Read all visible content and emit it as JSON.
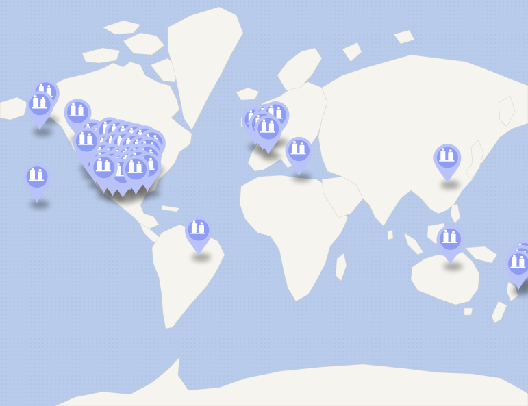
{
  "colors": {
    "water": "#b8cbea",
    "water_dots": "#a9bee3",
    "land": "#f6f4ee",
    "land_edge": "#d9d6cd",
    "marker_fill": "#8e9df2",
    "marker_ring": "#b9c3f7",
    "marker_shadow": "#000000",
    "icon": "#ffffff"
  },
  "map": {
    "icon_name": "storage-tanks-icon",
    "markers": [
      {
        "id": "alaska-1",
        "lon": -150,
        "lat": 62
      },
      {
        "id": "alaska-2",
        "lon": -154,
        "lat": 58
      },
      {
        "id": "canada-west",
        "lon": -128,
        "lat": 55
      },
      {
        "id": "hawaii",
        "lon": -156,
        "lat": 21
      },
      {
        "id": "usa-1",
        "lon": -118,
        "lat": 46
      },
      {
        "id": "usa-2",
        "lon": -112,
        "lat": 44
      },
      {
        "id": "usa-3",
        "lon": -106,
        "lat": 47
      },
      {
        "id": "usa-4",
        "lon": -100,
        "lat": 46
      },
      {
        "id": "usa-5",
        "lon": -94,
        "lat": 45
      },
      {
        "id": "usa-6",
        "lon": -88,
        "lat": 44
      },
      {
        "id": "usa-7",
        "lon": -82,
        "lat": 43
      },
      {
        "id": "usa-8",
        "lon": -77,
        "lat": 41
      },
      {
        "id": "usa-9",
        "lon": -120,
        "lat": 38
      },
      {
        "id": "usa-10",
        "lon": -114,
        "lat": 38
      },
      {
        "id": "usa-11",
        "lon": -108,
        "lat": 39
      },
      {
        "id": "usa-12",
        "lon": -102,
        "lat": 40
      },
      {
        "id": "usa-13",
        "lon": -96,
        "lat": 40
      },
      {
        "id": "usa-14",
        "lon": -90,
        "lat": 39
      },
      {
        "id": "usa-15",
        "lon": -84,
        "lat": 38
      },
      {
        "id": "usa-16",
        "lon": -79,
        "lat": 37
      },
      {
        "id": "usa-17",
        "lon": -116,
        "lat": 33
      },
      {
        "id": "usa-18",
        "lon": -110,
        "lat": 34
      },
      {
        "id": "usa-19",
        "lon": -104,
        "lat": 33
      },
      {
        "id": "usa-20",
        "lon": -98,
        "lat": 32
      },
      {
        "id": "usa-21",
        "lon": -92,
        "lat": 33
      },
      {
        "id": "usa-22",
        "lon": -86,
        "lat": 33
      },
      {
        "id": "usa-23",
        "lon": -80,
        "lat": 33
      },
      {
        "id": "usa-24",
        "lon": -110,
        "lat": 30
      },
      {
        "id": "usa-25",
        "lon": -104,
        "lat": 29
      },
      {
        "id": "usa-26",
        "lon": -98,
        "lat": 28
      },
      {
        "id": "usa-27",
        "lon": -92,
        "lat": 29
      },
      {
        "id": "usa-28",
        "lon": -86,
        "lat": 30
      },
      {
        "id": "usa-29",
        "lon": -122,
        "lat": 42
      },
      {
        "id": "usa-30",
        "lon": -80,
        "lat": 28
      },
      {
        "id": "usa-31",
        "lon": -104,
        "lat": 25
      },
      {
        "id": "usa-32",
        "lon": -97,
        "lat": 24
      },
      {
        "id": "usa-33",
        "lon": -110,
        "lat": 27
      },
      {
        "id": "usa-34",
        "lon": -88,
        "lat": 26
      },
      {
        "id": "europe-1",
        "lon": -6,
        "lat": 52
      },
      {
        "id": "europe-2",
        "lon": 2,
        "lat": 53
      },
      {
        "id": "europe-3",
        "lon": 8,
        "lat": 54
      },
      {
        "id": "europe-4",
        "lon": -1,
        "lat": 50
      },
      {
        "id": "europe-5",
        "lon": 3,
        "lat": 48
      },
      {
        "id": "europe-6",
        "lon": 24,
        "lat": 37
      },
      {
        "id": "south-america",
        "lon": -45,
        "lat": -15
      },
      {
        "id": "east-asia",
        "lon": 126,
        "lat": 33
      },
      {
        "id": "australia",
        "lon": 128,
        "lat": -21
      },
      {
        "id": "new-zealand-1",
        "lon": 179,
        "lat": -30
      },
      {
        "id": "new-zealand-2",
        "lon": 177,
        "lat": -33
      },
      {
        "id": "new-zealand-3",
        "lon": 175,
        "lat": -36
      }
    ]
  }
}
